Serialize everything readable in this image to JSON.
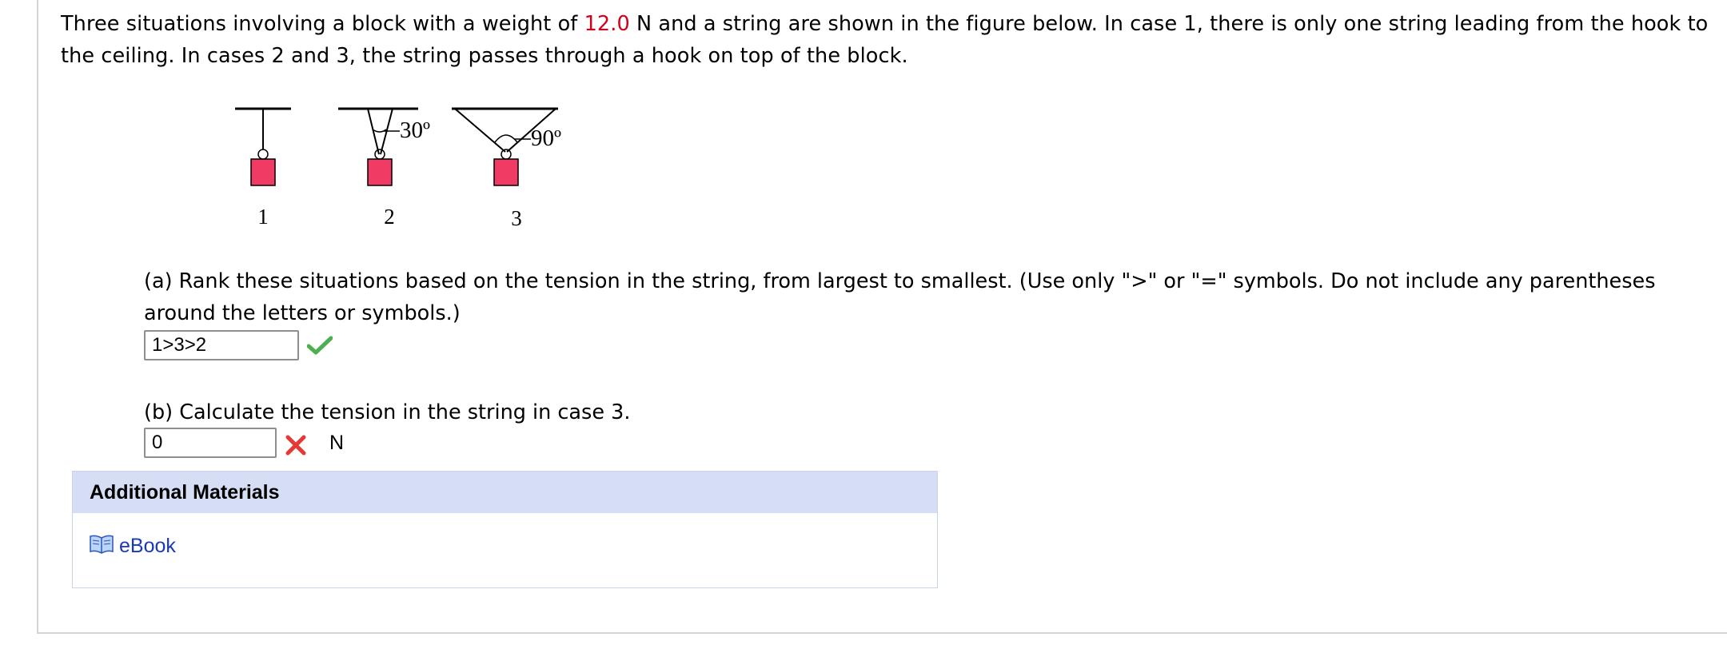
{
  "question": {
    "intro_before": "Three situations involving a block with a weight of ",
    "weight_value": "12.0",
    "intro_after": " N and a string are shown in the figure below. In case 1, there is only one string leading from the hook to the ceiling. In cases 2 and 3, the string passes through a hook on top of the block."
  },
  "figure": {
    "angle_case2": "30º",
    "angle_case3": "90º",
    "case_labels": [
      "1",
      "2",
      "3"
    ],
    "block_color": "#f03c64"
  },
  "part_a": {
    "prompt": "(a) Rank these situations based on the tension in the string, from largest to smallest. (Use only \">\" or \"=\" symbols. Do not include any parentheses around the letters or symbols.)",
    "answer": "1>3>2",
    "status": "correct",
    "status_icon": "check-icon",
    "status_color": "#4caf50"
  },
  "part_b": {
    "prompt": "(b) Calculate the tension in the string in case 3.",
    "answer": "0",
    "status": "incorrect",
    "status_icon": "x-icon",
    "status_color": "#e53935",
    "unit": "N"
  },
  "materials": {
    "header": "Additional Materials",
    "items": [
      {
        "label": "eBook",
        "icon": "book-icon"
      }
    ]
  }
}
